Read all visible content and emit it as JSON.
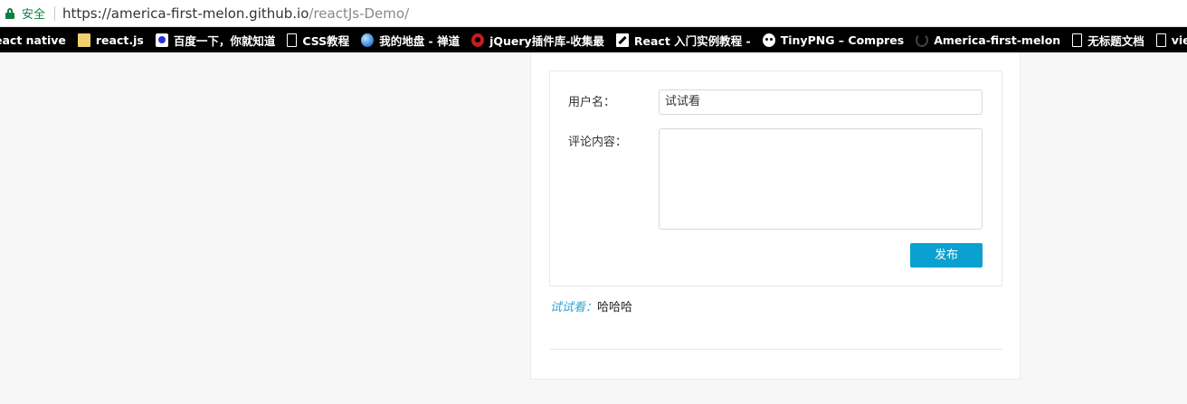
{
  "address_bar": {
    "secure_label": "安全",
    "url_domain": "https://america-first-melon.github.io",
    "url_path": "/reactJs-Demo/"
  },
  "bookmarks": [
    {
      "label": "eact native",
      "icon": "none"
    },
    {
      "label": "react.js",
      "icon": "folder-icon"
    },
    {
      "label": "百度一下，你就知道",
      "icon": "baidu-paw-icon"
    },
    {
      "label": "CSS教程",
      "icon": "page-icon"
    },
    {
      "label": "我的地盘 - 禅道",
      "icon": "globe-icon"
    },
    {
      "label": "jQuery插件库-收集最",
      "icon": "jquery-icon"
    },
    {
      "label": "React 入门实例教程 -",
      "icon": "react-tutorial-icon"
    },
    {
      "label": "TinyPNG – Compres",
      "icon": "tinypng-panda-icon"
    },
    {
      "label": "America-first-melon",
      "icon": "github-icon"
    },
    {
      "label": "无标题文档",
      "icon": "page-icon"
    },
    {
      "label": "view-source:ankane",
      "icon": "page-icon"
    }
  ],
  "form": {
    "username_label": "用户名：",
    "username_value": "试试看",
    "comment_label": "评论内容：",
    "comment_value": "",
    "submit_label": "发布"
  },
  "comments": [
    {
      "user": "试试看：",
      "content": "哈哈哈"
    }
  ],
  "colors": {
    "accent": "#0aa0cf",
    "comment_user": "#2fa6d6",
    "secure_green": "#0b8043"
  }
}
